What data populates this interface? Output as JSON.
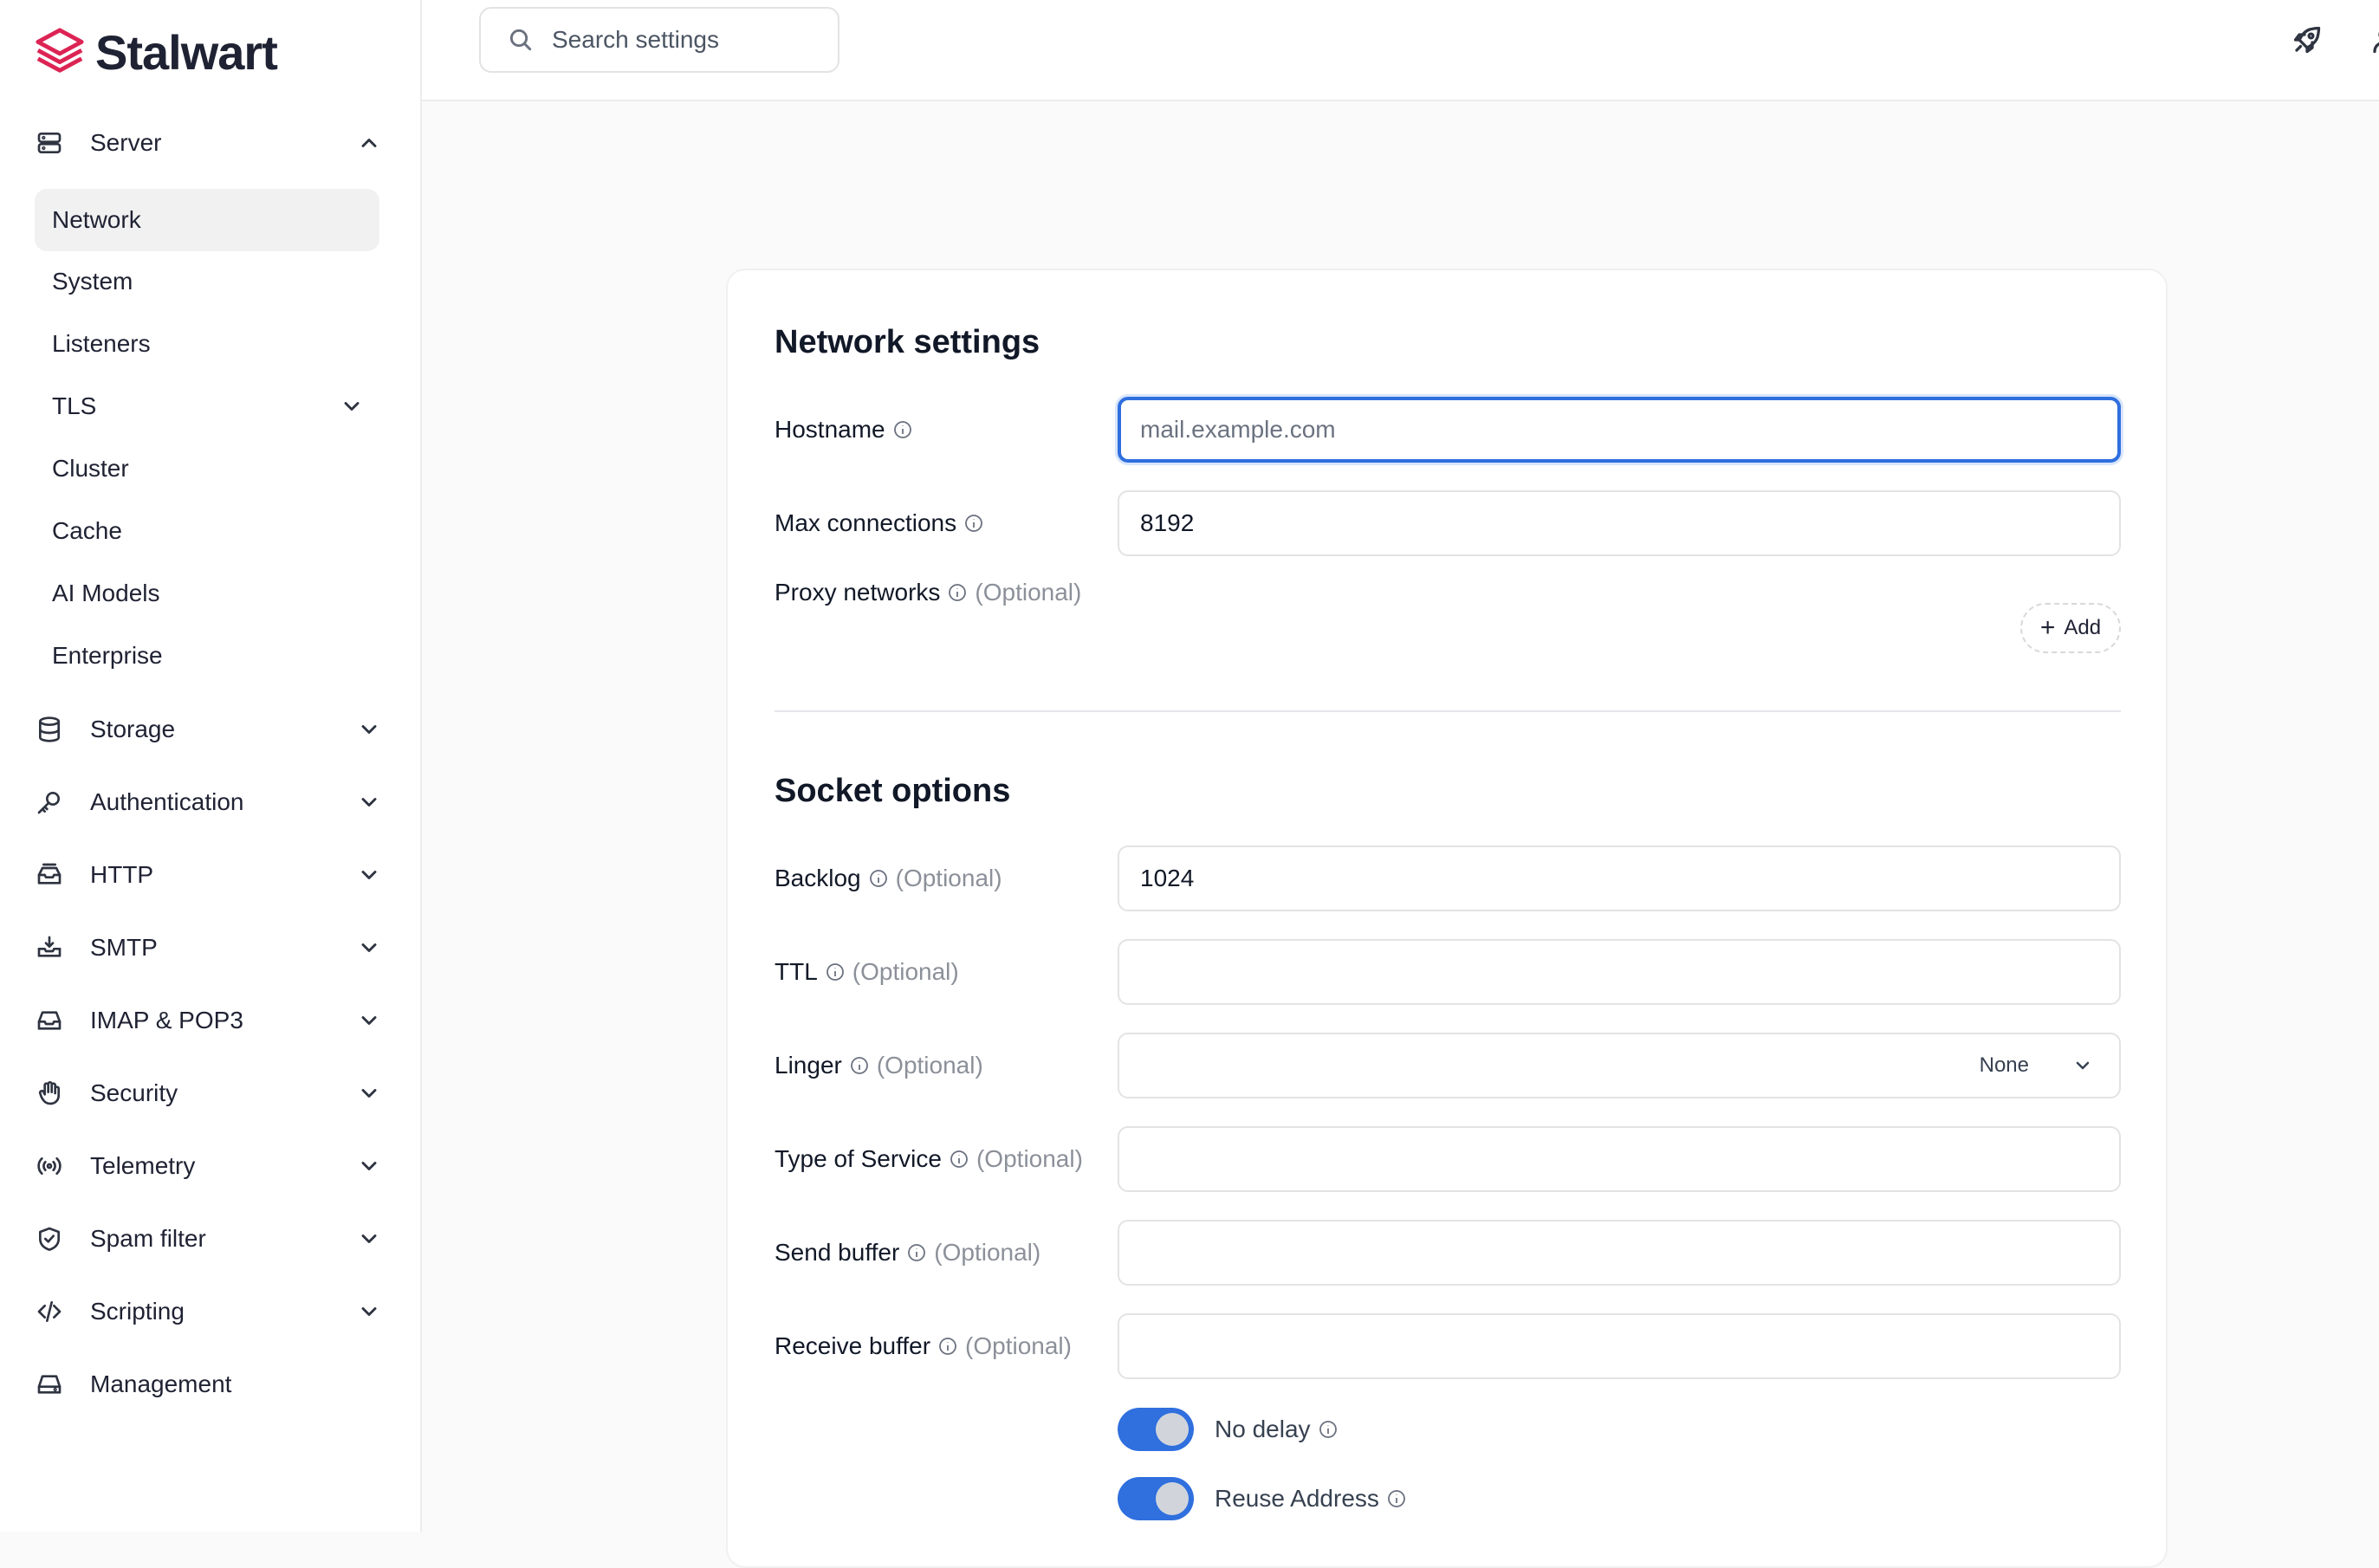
{
  "brand": {
    "name": "Stalwart",
    "color": "#dc2454"
  },
  "search": {
    "placeholder": "Search settings"
  },
  "sidebar": {
    "groups_top": [
      {
        "label": "Server",
        "icon": "server-icon",
        "expanded": true
      }
    ],
    "server_items": [
      {
        "label": "Network",
        "active": true
      },
      {
        "label": "System"
      },
      {
        "label": "Listeners"
      },
      {
        "label": "TLS",
        "has_children": true
      },
      {
        "label": "Cluster"
      },
      {
        "label": "Cache"
      },
      {
        "label": "AI Models"
      },
      {
        "label": "Enterprise"
      }
    ],
    "groups": [
      {
        "label": "Storage",
        "icon": "database-icon"
      },
      {
        "label": "Authentication",
        "icon": "key-icon"
      },
      {
        "label": "HTTP",
        "icon": "inbox-stack-icon"
      },
      {
        "label": "SMTP",
        "icon": "inbox-arrow-icon"
      },
      {
        "label": "IMAP & POP3",
        "icon": "inbox-icon"
      },
      {
        "label": "Security",
        "icon": "hand-icon"
      },
      {
        "label": "Telemetry",
        "icon": "signal-icon"
      },
      {
        "label": "Spam filter",
        "icon": "shield-check-icon"
      },
      {
        "label": "Scripting",
        "icon": "code-icon"
      },
      {
        "label": "Management",
        "icon": "drive-icon"
      }
    ]
  },
  "network": {
    "title": "Network settings",
    "hostname": {
      "label": "Hostname",
      "placeholder": "mail.example.com",
      "value": ""
    },
    "max_connections": {
      "label": "Max connections",
      "value": "8192"
    },
    "proxy_networks": {
      "label": "Proxy networks",
      "optional": "(Optional)",
      "add_label": "Add"
    }
  },
  "socket": {
    "title": "Socket options",
    "backlog": {
      "label": "Backlog",
      "optional": "(Optional)",
      "value": "1024"
    },
    "ttl": {
      "label": "TTL",
      "optional": "(Optional)",
      "value": ""
    },
    "linger": {
      "label": "Linger",
      "optional": "(Optional)",
      "value": "None"
    },
    "tos": {
      "label": "Type of Service",
      "optional": "(Optional)",
      "value": ""
    },
    "send_buffer": {
      "label": "Send buffer",
      "optional": "(Optional)",
      "value": ""
    },
    "receive_buffer": {
      "label": "Receive buffer",
      "optional": "(Optional)",
      "value": ""
    },
    "no_delay": {
      "label": "No delay",
      "enabled": true
    },
    "reuse_address": {
      "label": "Reuse Address",
      "enabled": true
    }
  },
  "colors": {
    "accent": "#2f6fde"
  }
}
